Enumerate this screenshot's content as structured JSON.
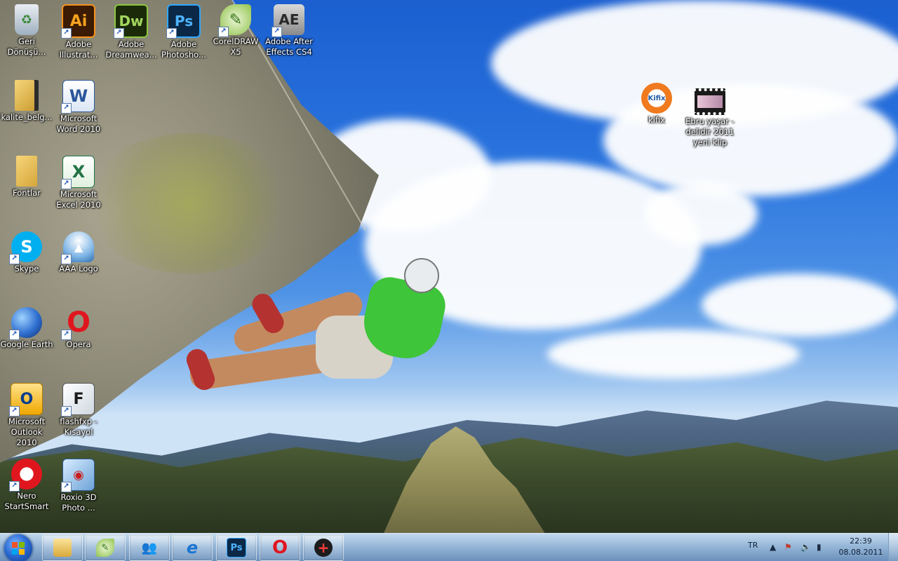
{
  "desktop": {
    "icons": [
      {
        "label": "Geri Dönüşü...",
        "icon": "recycle-bin-icon"
      },
      {
        "label": "Adobe Illustrat...",
        "icon": "illustrator-icon",
        "glyph": "Ai"
      },
      {
        "label": "Adobe Dreamwea...",
        "icon": "dreamweaver-icon",
        "glyph": "Dw"
      },
      {
        "label": "Adobe Photosho...",
        "icon": "photoshop-icon",
        "glyph": "Ps"
      },
      {
        "label": "CorelDRAW X5",
        "icon": "coreldraw-icon"
      },
      {
        "label": "Adobe After Effects CS4",
        "icon": "after-effects-icon",
        "glyph": "AE"
      },
      {
        "label": "kalite_belg...",
        "icon": "folder-icon"
      },
      {
        "label": "Microsoft Word 2010",
        "icon": "word-icon",
        "glyph": "W"
      },
      {
        "label": "Fontlar",
        "icon": "folder-icon"
      },
      {
        "label": "Microsoft Excel 2010",
        "icon": "excel-icon",
        "glyph": "X"
      },
      {
        "label": "Skype",
        "icon": "skype-icon",
        "glyph": "S"
      },
      {
        "label": "AAA Logo",
        "icon": "aaa-logo-icon"
      },
      {
        "label": "Google Earth",
        "icon": "google-earth-icon"
      },
      {
        "label": "Opera",
        "icon": "opera-icon",
        "glyph": "O"
      },
      {
        "label": "Microsoft Outlook 2010",
        "icon": "outlook-icon",
        "glyph": "O"
      },
      {
        "label": "flashfxp - Kısayol",
        "icon": "flashfxp-icon"
      },
      {
        "label": "Nero StartSmart",
        "icon": "nero-icon"
      },
      {
        "label": "Roxio 3D Photo ...",
        "icon": "roxio-icon"
      },
      {
        "label": "kifix",
        "icon": "kifix-icon",
        "glyph": "Kifix"
      },
      {
        "label": "Ebru yaşar - delidir 2011 yeni klip",
        "icon": "video-file-icon"
      }
    ]
  },
  "taskbar": {
    "pinned": [
      {
        "name": "explorer",
        "icon": "folder-icon"
      },
      {
        "name": "coreldraw",
        "icon": "coreldraw-icon"
      },
      {
        "name": "messenger",
        "icon": "messenger-icon"
      },
      {
        "name": "internet-explorer",
        "icon": "internet-explorer-icon",
        "glyph": "e"
      },
      {
        "name": "photoshop",
        "icon": "photoshop-icon",
        "glyph": "Ps"
      },
      {
        "name": "opera",
        "icon": "opera-icon",
        "glyph": "O"
      },
      {
        "name": "app",
        "icon": "red-plus-icon",
        "glyph": "+"
      }
    ],
    "language": "TR",
    "clock": {
      "time": "22:39",
      "date": "08.08.2011"
    }
  }
}
